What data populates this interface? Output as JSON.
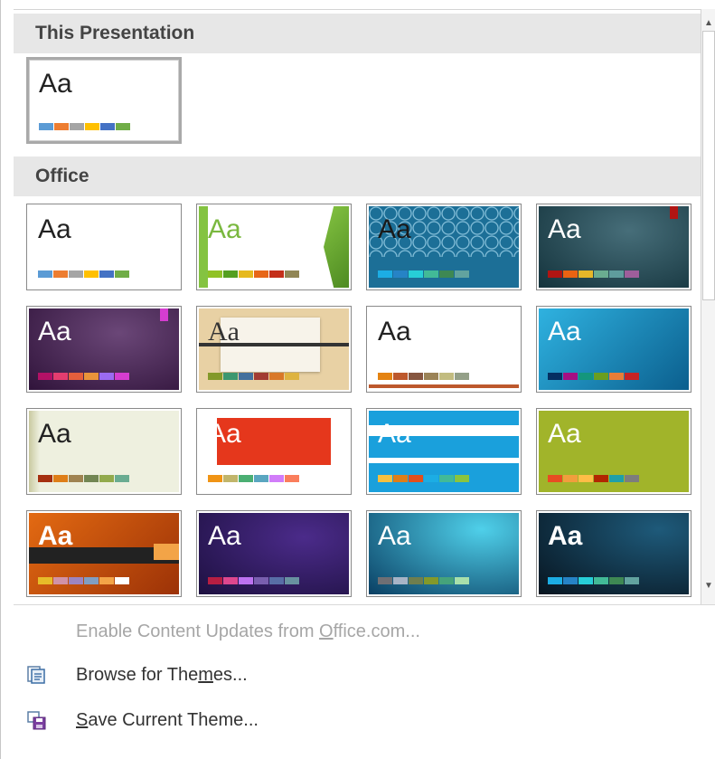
{
  "sections": {
    "this_presentation": "This Presentation",
    "office": "Office"
  },
  "current_theme": {
    "aa": "Aa",
    "bg": "#ffffff",
    "text": "#222222",
    "swatches": [
      "#5b9bd5",
      "#ed7d31",
      "#a5a5a5",
      "#ffc000",
      "#4472c4",
      "#70ad47"
    ]
  },
  "themes": [
    {
      "name": "office-theme",
      "aa": "Aa",
      "bg": "#ffffff",
      "text": "#222222",
      "swatches": [
        "#5b9bd5",
        "#ed7d31",
        "#a5a5a5",
        "#ffc000",
        "#4472c4",
        "#70ad47"
      ]
    },
    {
      "name": "facet",
      "aa": "Aa",
      "bg": "#ffffff",
      "text": "#7ab83f",
      "accent": "#84c341",
      "swatches": [
        "#90c226",
        "#54a021",
        "#e6b91e",
        "#e76618",
        "#c42f1a",
        "#918655"
      ]
    },
    {
      "name": "integral",
      "aa": "Aa",
      "bg": "#1c6f97",
      "text": "#1a1a1a",
      "pattern": true,
      "swatches": [
        "#1cade4",
        "#2683c6",
        "#27ced7",
        "#42ba97",
        "#3e8853",
        "#62a39f"
      ]
    },
    {
      "name": "ion-dark",
      "aa": "Aa",
      "bg": "#1e4e5c",
      "text": "#ffffff",
      "swatches": [
        "#b01513",
        "#ea6312",
        "#e6b729",
        "#6aac90",
        "#5f9c9d",
        "#9e5e9b"
      ]
    },
    {
      "name": "ion-boardroom",
      "aa": "Aa",
      "bg": "#4a1e5a",
      "text": "#ffffff",
      "swatches": [
        "#b31166",
        "#e33d6f",
        "#e45f3c",
        "#e9943a",
        "#9b6bf2",
        "#d53dd0"
      ]
    },
    {
      "name": "organic",
      "aa": "Aa",
      "bg": "#e8d1a4",
      "text": "#333333",
      "swatches": [
        "#83992a",
        "#3c9770",
        "#44709d",
        "#a23c33",
        "#d97828",
        "#deb340"
      ]
    },
    {
      "name": "retrospect",
      "aa": "Aa",
      "bg": "#ffffff",
      "text": "#222222",
      "swatches": [
        "#e48312",
        "#bd582c",
        "#865640",
        "#9b8357",
        "#c2bc80",
        "#94a088"
      ]
    },
    {
      "name": "slice",
      "aa": "Aa",
      "bg": "#1a8ac4",
      "text": "#ffffff",
      "swatches": [
        "#052f61",
        "#a50e82",
        "#14967c",
        "#6a9e1f",
        "#e87d37",
        "#c62324"
      ]
    },
    {
      "name": "wisp",
      "aa": "Aa",
      "bg": "#eef0df",
      "text": "#222222",
      "swatches": [
        "#a53010",
        "#de7e18",
        "#9f8351",
        "#728653",
        "#92aa4c",
        "#6aac91"
      ]
    },
    {
      "name": "berlin",
      "aa": "Aa",
      "bg": "#ffffff",
      "text": "#ffffff",
      "accent": "#e5371c",
      "swatches": [
        "#f09415",
        "#c1b56b",
        "#4baf73",
        "#5aa6c0",
        "#d17df9",
        "#fa7e5c"
      ]
    },
    {
      "name": "circuit",
      "aa": "Aa",
      "bg": "#ffffff",
      "text": "#ffffff",
      "accent": "#1aa0dc",
      "swatches": [
        "#f5c040",
        "#de7e18",
        "#e24f1c",
        "#1cade4",
        "#42ba97",
        "#8ac43f"
      ]
    },
    {
      "name": "dividend",
      "aa": "Aa",
      "bg": "#a1b42a",
      "text": "#ffffff",
      "swatches": [
        "#e84c22",
        "#f19e3d",
        "#ffbd47",
        "#b22600",
        "#1f9fa8",
        "#7d7d7d"
      ]
    },
    {
      "name": "frame",
      "aa": "Aa",
      "bg": "#d4560d",
      "text": "#ffffff",
      "swatches": [
        "#e7bc29",
        "#d092a7",
        "#9c85c0",
        "#809ec2",
        "#f3a447",
        "#ffffff"
      ]
    },
    {
      "name": "main-event",
      "aa": "Aa",
      "bg": "#2e1a5c",
      "text": "#ffffff",
      "swatches": [
        "#b71e42",
        "#de478e",
        "#bc72f0",
        "#795faf",
        "#586ea6",
        "#6892a0"
      ]
    },
    {
      "name": "mesh",
      "aa": "Aa",
      "bg": "#0f7fa6",
      "text": "#ffffff",
      "swatches": [
        "#6f6f74",
        "#a7b4c6",
        "#6f7e4e",
        "#83992a",
        "#46a37b",
        "#a8e0ab"
      ]
    },
    {
      "name": "savon",
      "aa": "Aa",
      "bg": "#0a1f30",
      "text": "#ffffff",
      "swatches": [
        "#1cade4",
        "#2683c6",
        "#27ced7",
        "#42ba97",
        "#3e8853",
        "#62a39f"
      ]
    }
  ],
  "menu": {
    "enable_updates": {
      "before": "Enable Content Updates from ",
      "hot": "O",
      "after": "ffice.com..."
    },
    "browse": {
      "before": "Browse for The",
      "hot": "m",
      "after": "es..."
    },
    "save": {
      "before": "",
      "hot": "S",
      "after": "ave Current Theme..."
    }
  },
  "scroll_up_glyph": "▲",
  "scroll_down_glyph": "▼"
}
